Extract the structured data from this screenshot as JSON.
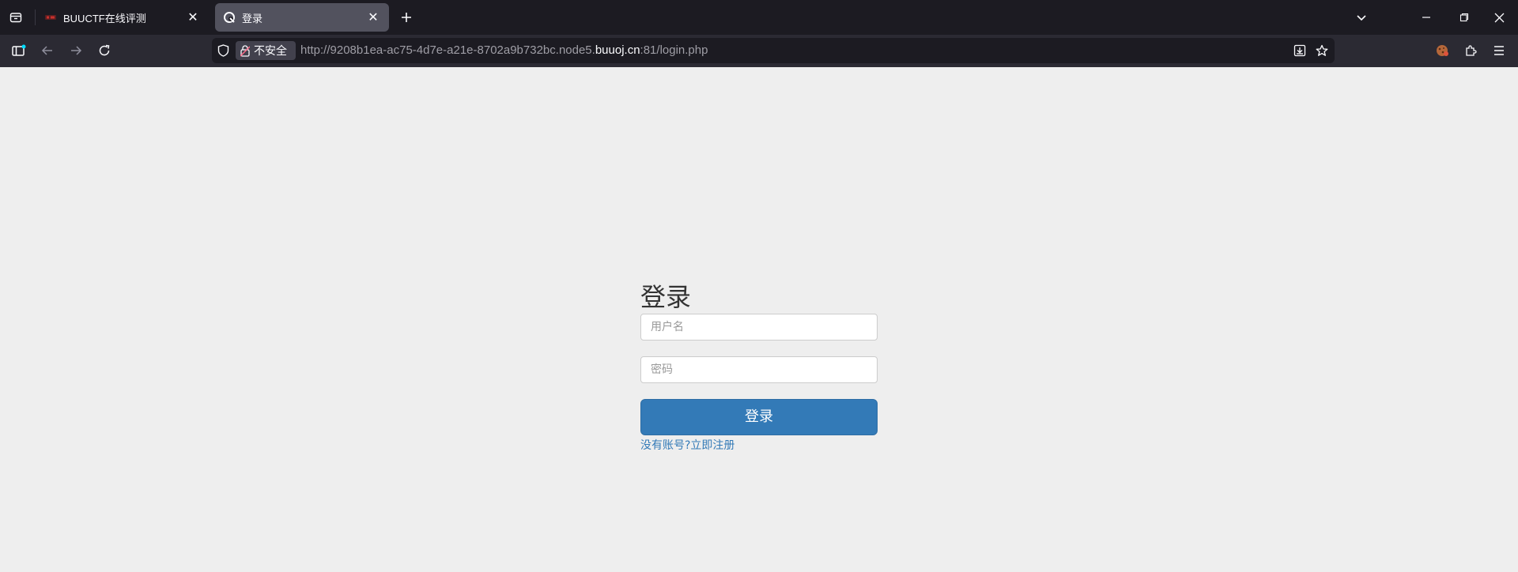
{
  "browser": {
    "tabs": [
      {
        "title": "BUUCTF在线评测",
        "active": false
      },
      {
        "title": "登录",
        "active": true
      }
    ],
    "address": {
      "security_label": "不安全",
      "url_prefix": "http://9208b1ea-ac75-4d7e-a21e-8702a9b732bc.node5.",
      "url_host": "buuoj.cn",
      "url_suffix": ":81/login.php"
    }
  },
  "login": {
    "heading": "登录",
    "username_placeholder": "用户名",
    "password_placeholder": "密码",
    "submit_label": "登录",
    "register_link": "没有账号?立即注册"
  },
  "colors": {
    "primary": "#337ab7",
    "page_bg": "#eeeeee",
    "chrome_bg": "#1c1b22",
    "toolbar_bg": "#2b2a33"
  }
}
